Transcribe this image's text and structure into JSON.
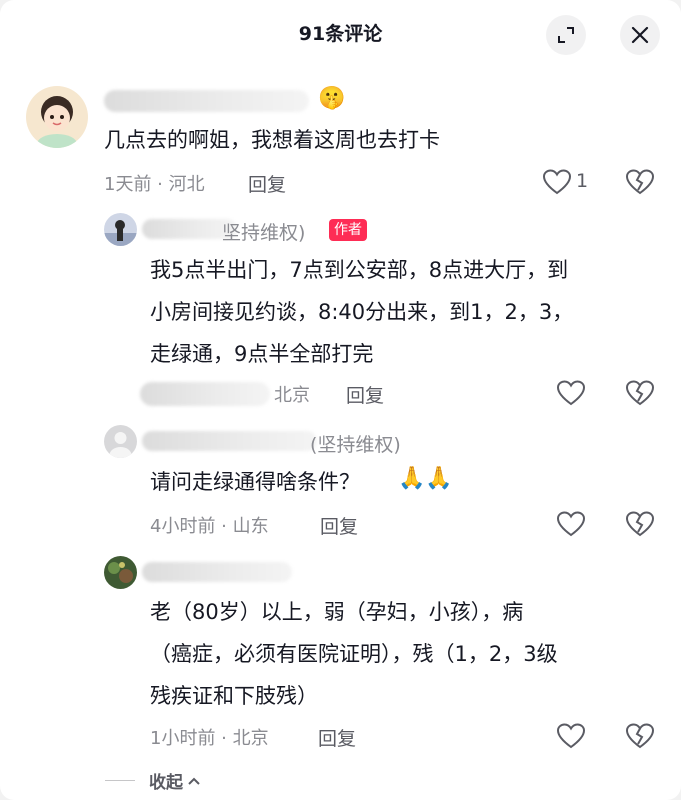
{
  "header": {
    "title": "91条评论",
    "expand_icon": "expand-icon",
    "close_icon": "close-icon"
  },
  "comments": [
    {
      "username_suffix": "",
      "emoji": "🤫",
      "lines": [
        "几点去的啊姐，我想着这周也去打卡"
      ],
      "time_location": "1天前 · 河北",
      "reply_label": "回复",
      "like_count": "1"
    },
    {
      "username_suffix": "坚持维权)",
      "author_badge": "作者",
      "lines": [
        "我5点半出门，7点到公安部，8点进大厅，到",
        "小房间接见约谈，8:40分出来，到1，2，3，",
        "走绿通，9点半全部打完"
      ],
      "time_location": "北京",
      "reply_label": "回复"
    },
    {
      "username_suffix": "(坚持维权)",
      "lines": [
        "请问走绿通得啥条件？"
      ],
      "emoji": "🙏🙏",
      "time_location": "4小时前 · 山东",
      "reply_label": "回复"
    },
    {
      "lines": [
        "老（80岁）以上，弱（孕妇，小孩），病",
        "（癌症，必须有医院证明），残（1，2，3级",
        "残疾证和下肢残）"
      ],
      "time_location": "1小时前 · 北京",
      "reply_label": "回复"
    }
  ],
  "collapse_label": "收起",
  "colors": {
    "badge": "#fe2c55",
    "meta": "#8a8b91",
    "text": "#161823"
  }
}
